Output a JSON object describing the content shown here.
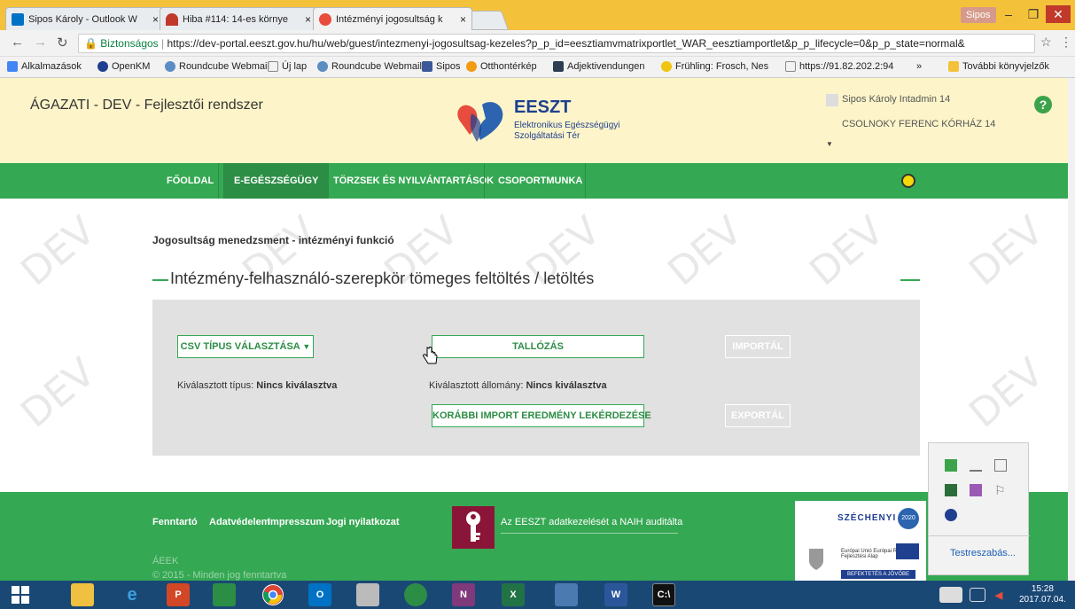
{
  "browser": {
    "tabs": [
      {
        "label": "Sipos Károly - Outlook W",
        "close": "×"
      },
      {
        "label": "Hiba #114: 14-es környe",
        "close": "×"
      },
      {
        "label": "Intézményi jogosultság k",
        "close": "×"
      }
    ],
    "user_badge": "Sipos",
    "secure_label": "Biztonságos",
    "url": "https://dev-portal.eeszt.gov.hu/hu/web/guest/intezmenyi-jogosultsag-kezeles?p_p_id=eesztiamvmatrixportlet_WAR_eesztiamportlet&p_p_lifecycle=0&p_p_state=normal&",
    "bookmarks": [
      "Alkalmazások",
      "OpenKM",
      "Roundcube Webmail",
      "Új lap",
      "Roundcube Webmail",
      "Sipos",
      "Otthontérkép",
      "Adjektivendungen",
      "Frühling: Frosch, Nes",
      "https://91.82.202.2:94"
    ],
    "more_bookmarks": "»",
    "other_bookmarks": "További könyvjelzők"
  },
  "header": {
    "system_title": "ÁGAZATI - DEV - Fejlesztői rendszer",
    "logo_title": "EESZT",
    "logo_sub1": "Elektronikus Egészségügyi",
    "logo_sub2": "Szolgáltatási Tér",
    "user_name": "Sipos Károly Intadmin 14",
    "hospital": "CSOLNOKY FERENC KÓRHÁZ 14",
    "help": "?"
  },
  "nav": {
    "items": [
      "FŐOLDAL",
      "E-EGÉSZSÉGÜGY",
      "TÖRZSEK ÉS NYILVÁNTARTÁSOK",
      "CSOPORTMUNKA"
    ],
    "active": "E-EGÉSZSÉGÜGY"
  },
  "watermark": "DEV",
  "main": {
    "breadcrumb": "Jogosultság menedzsment - intézményi funkció",
    "section_title": "Intézmény-felhasználó-szerepkör tömeges feltöltés / letöltés",
    "csv_button": "CSV TÍPUS VÁLASZTÁSA",
    "browse_button": "TALLÓZÁS",
    "import_button": "IMPORTÁL",
    "selected_type_label": "Kiválasztott típus:",
    "selected_type_value": "Nincs kiválasztva",
    "selected_file_label": "Kiválasztott állomány:",
    "selected_file_value": "Nincs kiválasztva",
    "previous_import_button": "KORÁBBI IMPORT EREDMÉNY LEKÉRDEZÉSE",
    "export_button": "EXPORTÁL"
  },
  "footer": {
    "links": [
      "Fenntartó",
      "Adatvédelem",
      "Impresszum",
      "Jogi nyilatkozat"
    ],
    "naih_text": "Az EESZT adatkezelését a NAIH auditálta",
    "org": "ÁEEK",
    "copyright": "© 2015 - Minden jog fenntartva",
    "szechenyi": "SZÉCHENYI",
    "szechenyi_year": "2020",
    "eu_text": "Európai Unió Európai Regionális Fejlesztési Alap",
    "invest_text": "BEFEKTETÉS A JÖVŐBE"
  },
  "tray_popup": {
    "customize": "Testreszabás..."
  },
  "taskbar": {
    "time": "15:28",
    "date": "2017.07.04."
  }
}
